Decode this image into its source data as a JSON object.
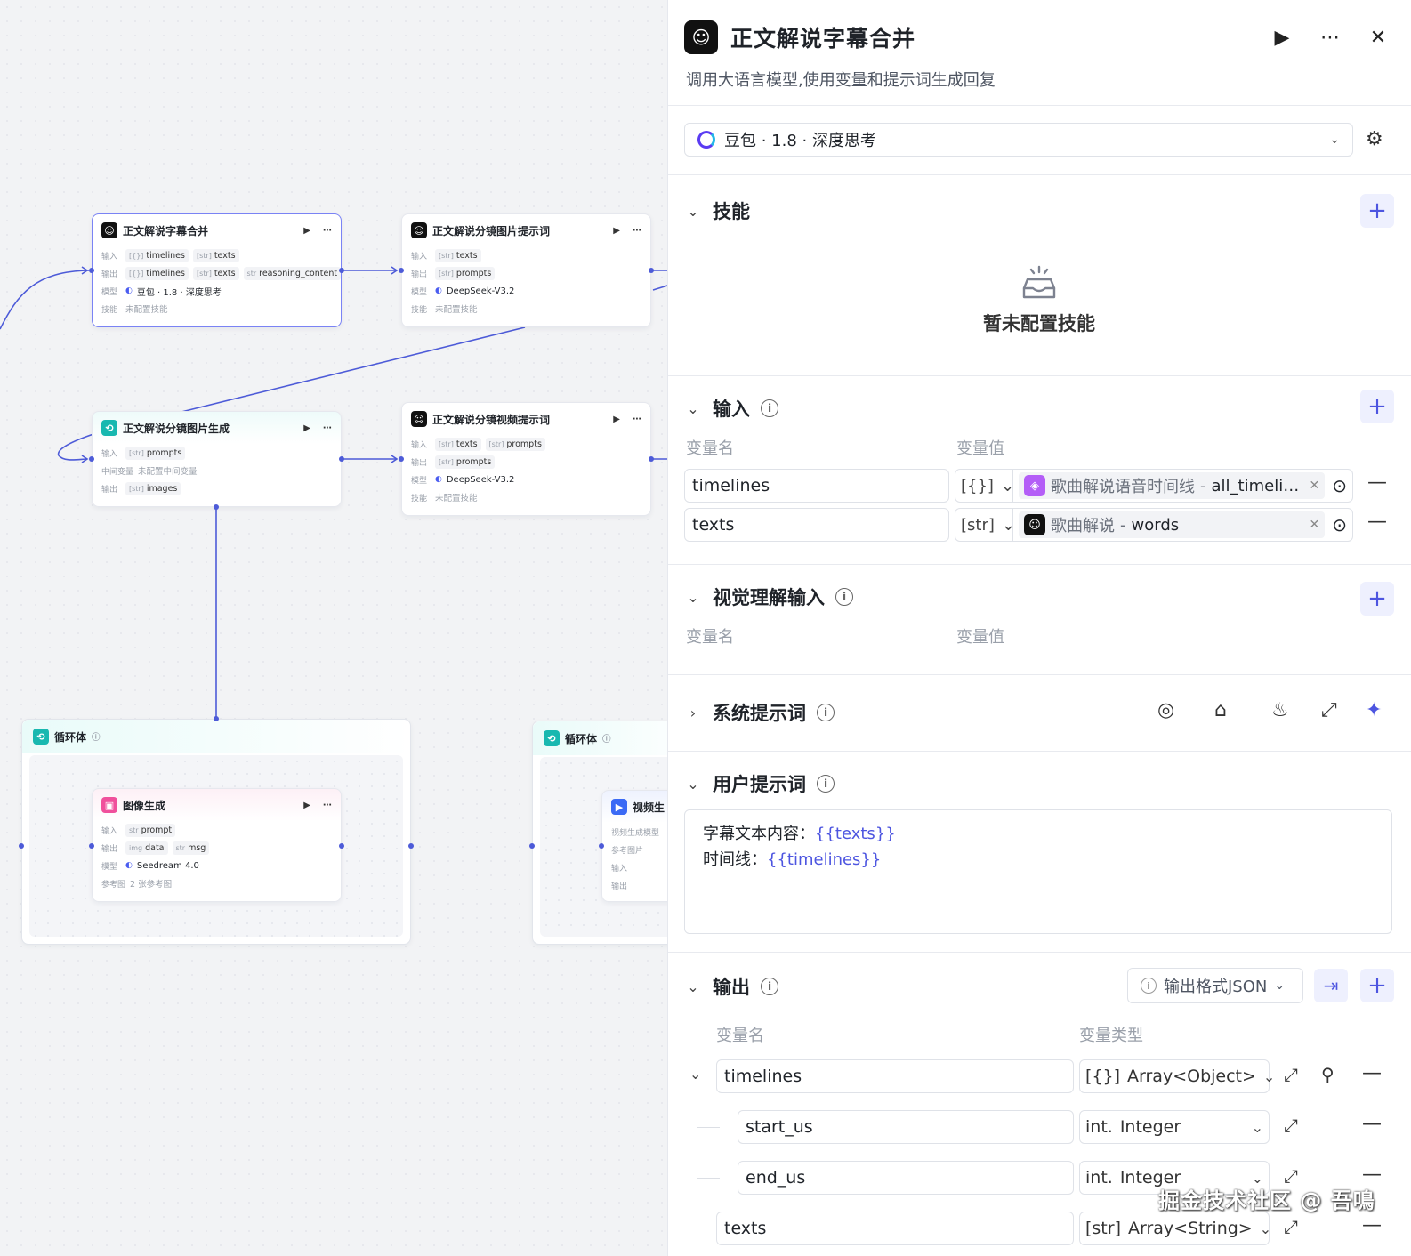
{
  "canvas": {
    "nodes": [
      {
        "id": "n1",
        "title": "正文解说字幕合并",
        "icon": "llm-icon",
        "rows": [
          {
            "label": "输入",
            "chips": [
              [
                "[{}]",
                "timelines"
              ],
              [
                "[str]",
                "texts"
              ]
            ]
          },
          {
            "label": "输出",
            "chips": [
              [
                "[{}]",
                "timelines"
              ],
              [
                "[str]",
                "texts"
              ],
              [
                "str",
                "reasoning_content"
              ]
            ]
          },
          {
            "label": "模型",
            "text": "豆包 · 1.8 · 深度思考"
          },
          {
            "label": "技能",
            "text": "未配置技能"
          }
        ]
      },
      {
        "id": "n2",
        "title": "正文解说分镜图片提示词",
        "icon": "llm-icon",
        "rows": [
          {
            "label": "输入",
            "chips": [
              [
                "[str]",
                "texts"
              ]
            ]
          },
          {
            "label": "输出",
            "chips": [
              [
                "[str]",
                "prompts"
              ]
            ]
          },
          {
            "label": "模型",
            "text": "DeepSeek-V3.2"
          },
          {
            "label": "技能",
            "text": "未配置技能"
          }
        ]
      },
      {
        "id": "n3",
        "title": "正文解说分镜图片生成",
        "icon": "loop-icon",
        "rows": [
          {
            "label": "输入",
            "chips": [
              [
                "[str]",
                "prompts"
              ]
            ]
          },
          {
            "label": "中间变量",
            "text": "未配置中间变量"
          },
          {
            "label": "输出",
            "chips": [
              [
                "[str]",
                "images"
              ]
            ]
          }
        ]
      },
      {
        "id": "n4",
        "title": "正文解说分镜视频提示词",
        "icon": "llm-icon",
        "rows": [
          {
            "label": "输入",
            "chips": [
              [
                "[str]",
                "texts"
              ],
              [
                "[str]",
                "prompts"
              ]
            ]
          },
          {
            "label": "输出",
            "chips": [
              [
                "[str]",
                "prompts"
              ]
            ]
          },
          {
            "label": "模型",
            "text": "DeepSeek-V3.2"
          },
          {
            "label": "技能",
            "text": "未配置技能"
          }
        ]
      },
      {
        "id": "n5",
        "title": "图像生成",
        "icon": "image-gen-icon",
        "rows": [
          {
            "label": "输入",
            "chips": [
              [
                "str",
                "prompt"
              ]
            ]
          },
          {
            "label": "输出",
            "chips": [
              [
                "img",
                "data"
              ],
              [
                "str",
                "msg"
              ]
            ]
          },
          {
            "label": "模型",
            "text": "Seedream 4.0"
          },
          {
            "label": "参考图",
            "text": "2 张参考图"
          }
        ]
      },
      {
        "id": "n6",
        "title": "视频生",
        "icon": "video-gen-icon",
        "rows": [
          {
            "label": "视频生成模型",
            "text": ""
          },
          {
            "label": "参考图片",
            "text": ""
          },
          {
            "label": "输入",
            "text": ""
          },
          {
            "label": "输出",
            "text": ""
          }
        ]
      }
    ],
    "loops": [
      {
        "id": "l1",
        "title": "循环体"
      },
      {
        "id": "l2",
        "title": "循环体"
      }
    ]
  },
  "panel": {
    "title": "正文解说字幕合并",
    "description": "调用大语言模型,使用变量和提示词生成回复",
    "model": "豆包 · 1.8 · 深度思考",
    "skills": {
      "title": "技能",
      "empty": "暂未配置技能"
    },
    "inputs": {
      "title": "输入",
      "col_name": "变量名",
      "col_value": "变量值",
      "rows": [
        {
          "name": "timelines",
          "type": "[{}]",
          "source": "歌曲解说语音时间线",
          "sep": " - ",
          "var": "all_timeli…"
        },
        {
          "name": "texts",
          "type": "[str]",
          "source": "歌曲解说",
          "sep": " - ",
          "var": "words"
        }
      ]
    },
    "vision": {
      "title": "视觉理解输入",
      "col_name": "变量名",
      "col_value": "变量值"
    },
    "system_prompt": {
      "title": "系统提示词"
    },
    "user_prompt": {
      "title": "用户提示词",
      "line1_label": "字幕文本内容：",
      "line1_var": "{{texts}}",
      "line2_label": "时间线：",
      "line2_var": "{{timelines}}"
    },
    "outputs": {
      "title": "输出",
      "format": "输出格式JSON",
      "col_name": "变量名",
      "col_type": "变量类型",
      "rows": [
        {
          "name": "timelines",
          "type_icon": "[{}]",
          "type": "Array<Object>"
        },
        {
          "name": "start_us",
          "type_icon": "int.",
          "type": "Integer"
        },
        {
          "name": "end_us",
          "type_icon": "int.",
          "type": "Integer"
        },
        {
          "name": "texts",
          "type_icon": "[str]",
          "type": "Array<String>"
        }
      ]
    }
  },
  "watermark": "掘金技术社区 @ 吾鳴",
  "colors": {
    "accent": "#4d55e0",
    "edge": "#4d5bd8",
    "selected_border": "#7a83f5"
  }
}
